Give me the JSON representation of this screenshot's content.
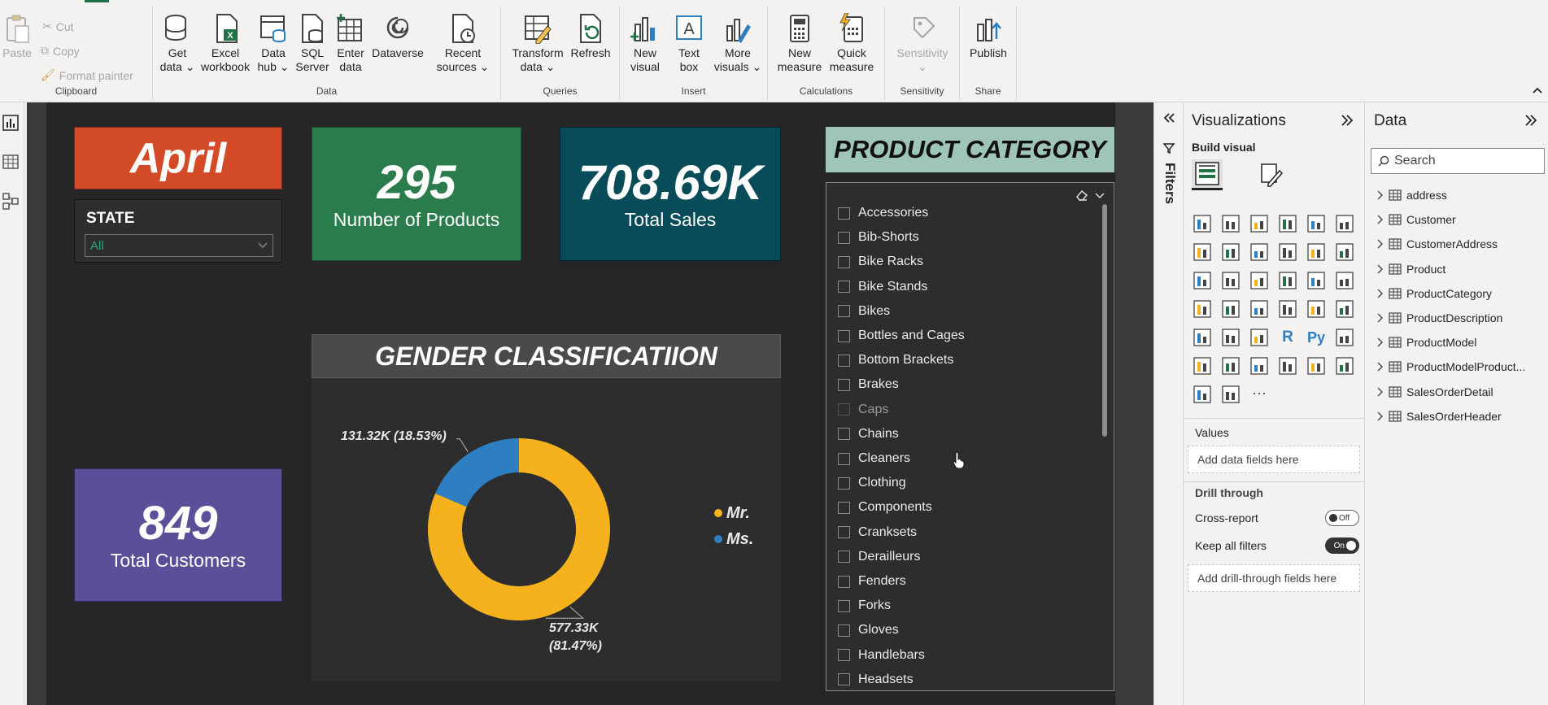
{
  "ribbon": {
    "clipboard": {
      "label": "Clipboard",
      "paste": "Paste",
      "cut": "Cut",
      "copy": "Copy",
      "format_painter": "Format painter"
    },
    "data": {
      "label": "Data",
      "get_data": [
        "Get",
        "data"
      ],
      "excel": [
        "Excel",
        "workbook"
      ],
      "data_hub": [
        "Data",
        "hub"
      ],
      "sql": [
        "SQL",
        "Server"
      ],
      "enter_data": [
        "Enter",
        "data"
      ],
      "dataverse": "Dataverse",
      "recent": [
        "Recent",
        "sources"
      ]
    },
    "queries": {
      "label": "Queries",
      "transform": [
        "Transform",
        "data"
      ],
      "refresh": "Refresh"
    },
    "insert": {
      "label": "Insert",
      "new_visual": [
        "New",
        "visual"
      ],
      "text_box": [
        "Text",
        "box"
      ],
      "more_visuals": [
        "More",
        "visuals"
      ]
    },
    "calculations": {
      "label": "Calculations",
      "new_measure": [
        "New",
        "measure"
      ],
      "quick_measure": [
        "Quick",
        "measure"
      ]
    },
    "sensitivity": {
      "label": "Sensitivity",
      "btn": "Sensitivity"
    },
    "share": {
      "label": "Share",
      "publish": "Publish"
    }
  },
  "report": {
    "month": "April",
    "state_slicer": {
      "title": "STATE",
      "value": "All"
    },
    "products": {
      "value": "295",
      "label": "Number of Products"
    },
    "sales": {
      "value": "708.69K",
      "label": "Total Sales"
    },
    "customers": {
      "value": "849",
      "label": "Total Customers"
    },
    "gender_title": "GENDER CLASSIFICATIION",
    "product_category_title": "PRODUCT CATEGORY",
    "product_categories": [
      "Accessories",
      "Bib-Shorts",
      "Bike Racks",
      "Bike Stands",
      "Bikes",
      "Bottles and Cages",
      "Bottom Brackets",
      "Brakes",
      "Caps",
      "Chains",
      "Cleaners",
      "Clothing",
      "Components",
      "Cranksets",
      "Derailleurs",
      "Fenders",
      "Forks",
      "Gloves",
      "Handlebars",
      "Headsets"
    ]
  },
  "chart_data": {
    "type": "pie",
    "donut": true,
    "categories": [
      "Mr.",
      "Ms."
    ],
    "values": [
      577.33,
      131.32
    ],
    "value_labels": [
      "577.33K",
      "131.32K"
    ],
    "percent_labels": [
      "(81.47%)",
      "(18.53%)"
    ],
    "colors": [
      "#f5b21c",
      "#2d7fc2"
    ],
    "legend_position": "right"
  },
  "panes": {
    "filters_label": "Filters",
    "visualizations": {
      "title": "Visualizations",
      "build_visual": "Build visual",
      "values_label": "Values",
      "values_placeholder": "Add data fields here",
      "drill_through": "Drill through",
      "cross_report": "Cross-report",
      "cross_report_state": "Off",
      "keep_filters": "Keep all filters",
      "keep_filters_state": "On",
      "drill_placeholder": "Add drill-through fields here",
      "r_label": "R",
      "py_label": "Py",
      "more_label": "···"
    },
    "data": {
      "title": "Data",
      "search_placeholder": "Search",
      "tables": [
        "address",
        "Customer",
        "CustomerAddress",
        "Product",
        "ProductCategory",
        "ProductDescription",
        "ProductModel",
        "ProductModelProduct...",
        "SalesOrderDetail",
        "SalesOrderHeader"
      ]
    }
  },
  "colors": {
    "ribbon_bg": "#f3f2f1",
    "month": "#d24a26",
    "products": "#2b7c4c",
    "sales": "#074c58",
    "customers": "#5b4f9a",
    "product_category_header": "#9ec5b5",
    "report_bg": "#262626"
  }
}
